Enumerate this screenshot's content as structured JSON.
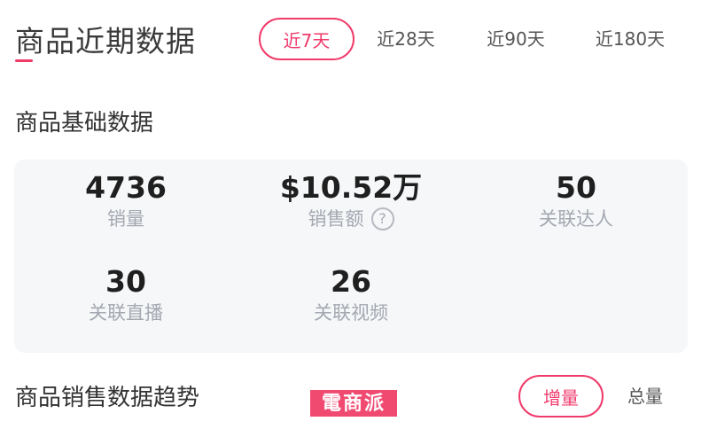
{
  "header": {
    "title": "商品近期数据"
  },
  "range_tabs": [
    {
      "label": "近7天",
      "active": true
    },
    {
      "label": "近28天",
      "active": false
    },
    {
      "label": "近90天",
      "active": false
    },
    {
      "label": "近180天",
      "active": false
    }
  ],
  "basic": {
    "title": "商品基础数据",
    "stats": [
      {
        "value": "4736",
        "label": "销量"
      },
      {
        "value": "$10.52万",
        "label": "销售额",
        "has_help": true
      },
      {
        "value": "50",
        "label": "关联达人"
      },
      {
        "value": "30",
        "label": "关联直播"
      },
      {
        "value": "26",
        "label": "关联视频"
      }
    ],
    "help_glyph": "?"
  },
  "trend": {
    "title": "商品销售数据趋势",
    "modes": [
      {
        "label": "增量",
        "active": true
      },
      {
        "label": "总量",
        "active": false
      }
    ]
  },
  "watermark": {
    "text": "電商派"
  },
  "colors": {
    "accent": "#f03a6a",
    "card_bg": "#f6f7f9",
    "label_gray": "#a4a8b0"
  }
}
